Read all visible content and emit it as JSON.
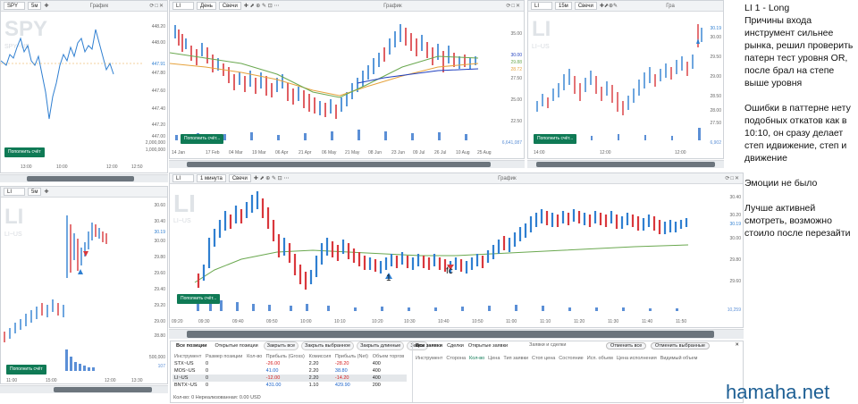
{
  "panels": {
    "spy": {
      "symbol": "SPY",
      "tf": "5м",
      "graph": "График",
      "wm": "SPY",
      "wm2": "SPY~US",
      "yticks": [
        "448.20",
        "448.00",
        "447.91",
        "447.80",
        "447.60",
        "447.40",
        "447.20",
        "447.00"
      ],
      "vol_ticks": [
        "2,000,000",
        "1,000,000"
      ],
      "xticks": [
        "13:00",
        "10:00",
        "12:00",
        "12:50"
      ],
      "btn": "Пополнить счёт"
    },
    "li_daily": {
      "symbol": "LI",
      "tf": "День",
      "type": "Свечи",
      "graph": "График",
      "yticks": [
        "35.00",
        "30.00",
        "29.88",
        "28.72",
        "27.50",
        "25.00",
        "22.50"
      ],
      "vol": "6,641,087",
      "xticks": [
        "14 Jan",
        "17 Feb",
        "04 Mar",
        "19 Mar",
        "06 Apr",
        "21 Apr",
        "06 May",
        "21 May",
        "08 Jun",
        "23 Jun",
        "09 Jul",
        "26 Jul",
        "10 Aug",
        "25 Aug"
      ],
      "btn": "Пополнить счёт..."
    },
    "li_15": {
      "symbol": "LI",
      "tf": "15м",
      "type": "Свечи",
      "graph": "Гра",
      "wm": "LI",
      "wm2": "LI~US",
      "yticks": [
        "30.19",
        "30.00",
        "29.50",
        "29.00",
        "28.50",
        "28.00",
        "27.50"
      ],
      "xticks": [
        "14:00",
        "12:00",
        "12:00"
      ],
      "vol": "6,902",
      "btn": "Пополнить счёт..."
    },
    "li_5": {
      "symbol": "LI",
      "tf": "5м",
      "wm": "LI",
      "wm2": "LI~US",
      "yticks": [
        "30.60",
        "30.40",
        "30.19",
        "30.00",
        "29.80",
        "29.60",
        "29.40",
        "29.20",
        "29.00",
        "28.80"
      ],
      "vol": "500,000",
      "vol2": "107",
      "xticks": [
        "11:00",
        "15:00",
        "12:00",
        "13:30"
      ],
      "btn": "Пополнить счёт"
    },
    "li_1": {
      "symbol": "LI",
      "tf": "1 минута",
      "type": "Свечи",
      "graph": "График",
      "wm": "LI",
      "wm2": "LI~US",
      "yticks": [
        "30.40",
        "30.20",
        "30.19",
        "30.00",
        "29.80",
        "29.60"
      ],
      "vol": "10,259",
      "xticks": [
        "09:20",
        "09:30",
        "09:40",
        "09:50",
        "10:00",
        "10:10",
        "10:20",
        "10:30",
        "10:40",
        "10:50",
        "11:00",
        "11:10",
        "11:20",
        "11:30",
        "11:40",
        "11:50"
      ],
      "btn": "Пополнить счёт...",
      "mark1": "1",
      "mark2": "fc"
    }
  },
  "positions": {
    "tabs": [
      "Все позиции",
      "Открытые позиции",
      "Закрыть все",
      "Закрыть выбранное",
      "Закрыть длинные",
      "Закры"
    ],
    "headers": [
      "Инструмент",
      "Размер позиции",
      "Кол-во",
      "Прибыль (Gross)",
      "Комиссия",
      "Прибыль (Net)",
      "Объем торгов"
    ],
    "rows": [
      {
        "sym": "STX~US",
        "size": "0",
        "qty": "",
        "gross": "-26.00",
        "comm": "2.20",
        "net": "-28.20",
        "vol": "400"
      },
      {
        "sym": "MOS~US",
        "size": "0",
        "qty": "",
        "gross": "41.00",
        "comm": "2.20",
        "net": "38.80",
        "vol": "400"
      },
      {
        "sym": "LI~US",
        "size": "0",
        "qty": "",
        "gross": "-12.00",
        "comm": "2.20",
        "net": "-14.20",
        "vol": "400"
      },
      {
        "sym": "BNTX~US",
        "size": "0",
        "qty": "",
        "gross": "431.00",
        "comm": "1.10",
        "net": "429.90",
        "vol": "200"
      }
    ],
    "footer": "Кол-во: 0   Нереализованная: 0.00 USD"
  },
  "orders": {
    "tabs": [
      "Все заявки",
      "Сделки",
      "Открытые заявки"
    ],
    "title": "Заявки и сделки",
    "cancel_all": "Отменить все",
    "cancel_sel": "Отменить выбранные",
    "cols": [
      "Инструмент",
      "Сторона",
      "Кол-во",
      "Цена",
      "Тип заявки",
      "Стоп цена",
      "Состояние",
      "Исп. объем",
      "Цена исполнения",
      "Видимый объем"
    ]
  },
  "note": {
    "title": "LI 1 - Long",
    "p1": "Причины входа инструмент сильнее рынка, решил проверить патерн тест уровня OR, после брал на степе выше уровня",
    "p2": "Ошибки в паттерне нету подобных откатов как в 10:10, он сразу делает степ идвижение, степ и движение",
    "p3": "Эмоции не было",
    "p4": "Лучше активней смотреть, возможно стоило после перезайти"
  },
  "brand": "hamaha.net",
  "colors": {
    "up": "#2f7fd1",
    "down": "#d9373c",
    "ma_green": "#6aa84f",
    "ma_orange": "#e6a23c",
    "ma_blue": "#1f3fbf",
    "volume": "#5b8fd6"
  }
}
